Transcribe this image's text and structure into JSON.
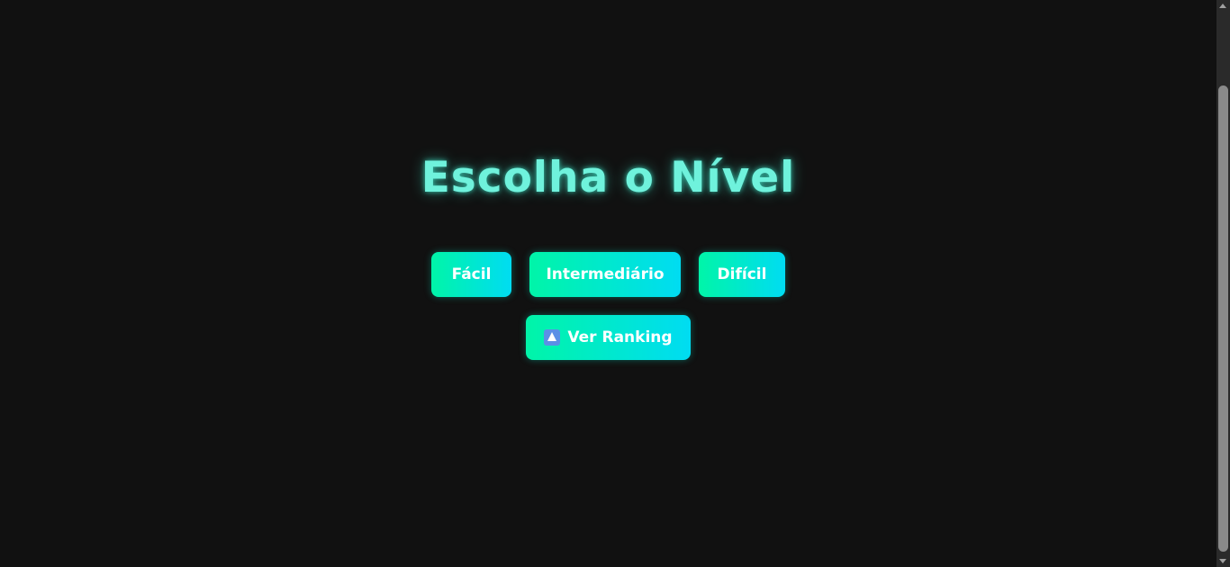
{
  "page": {
    "title": "Escolha o Nível"
  },
  "levels": [
    {
      "label": "Fácil"
    },
    {
      "label": "Intermediário"
    },
    {
      "label": "Difícil"
    }
  ],
  "ranking": {
    "label": "Ver Ranking",
    "icon": "up-triangle-icon"
  },
  "colors": {
    "background": "#111111",
    "title": "#6ff2dc",
    "button_gradient_start": "#00f5a8",
    "button_gradient_end": "#00dcf2",
    "button_text": "#ffffff"
  }
}
